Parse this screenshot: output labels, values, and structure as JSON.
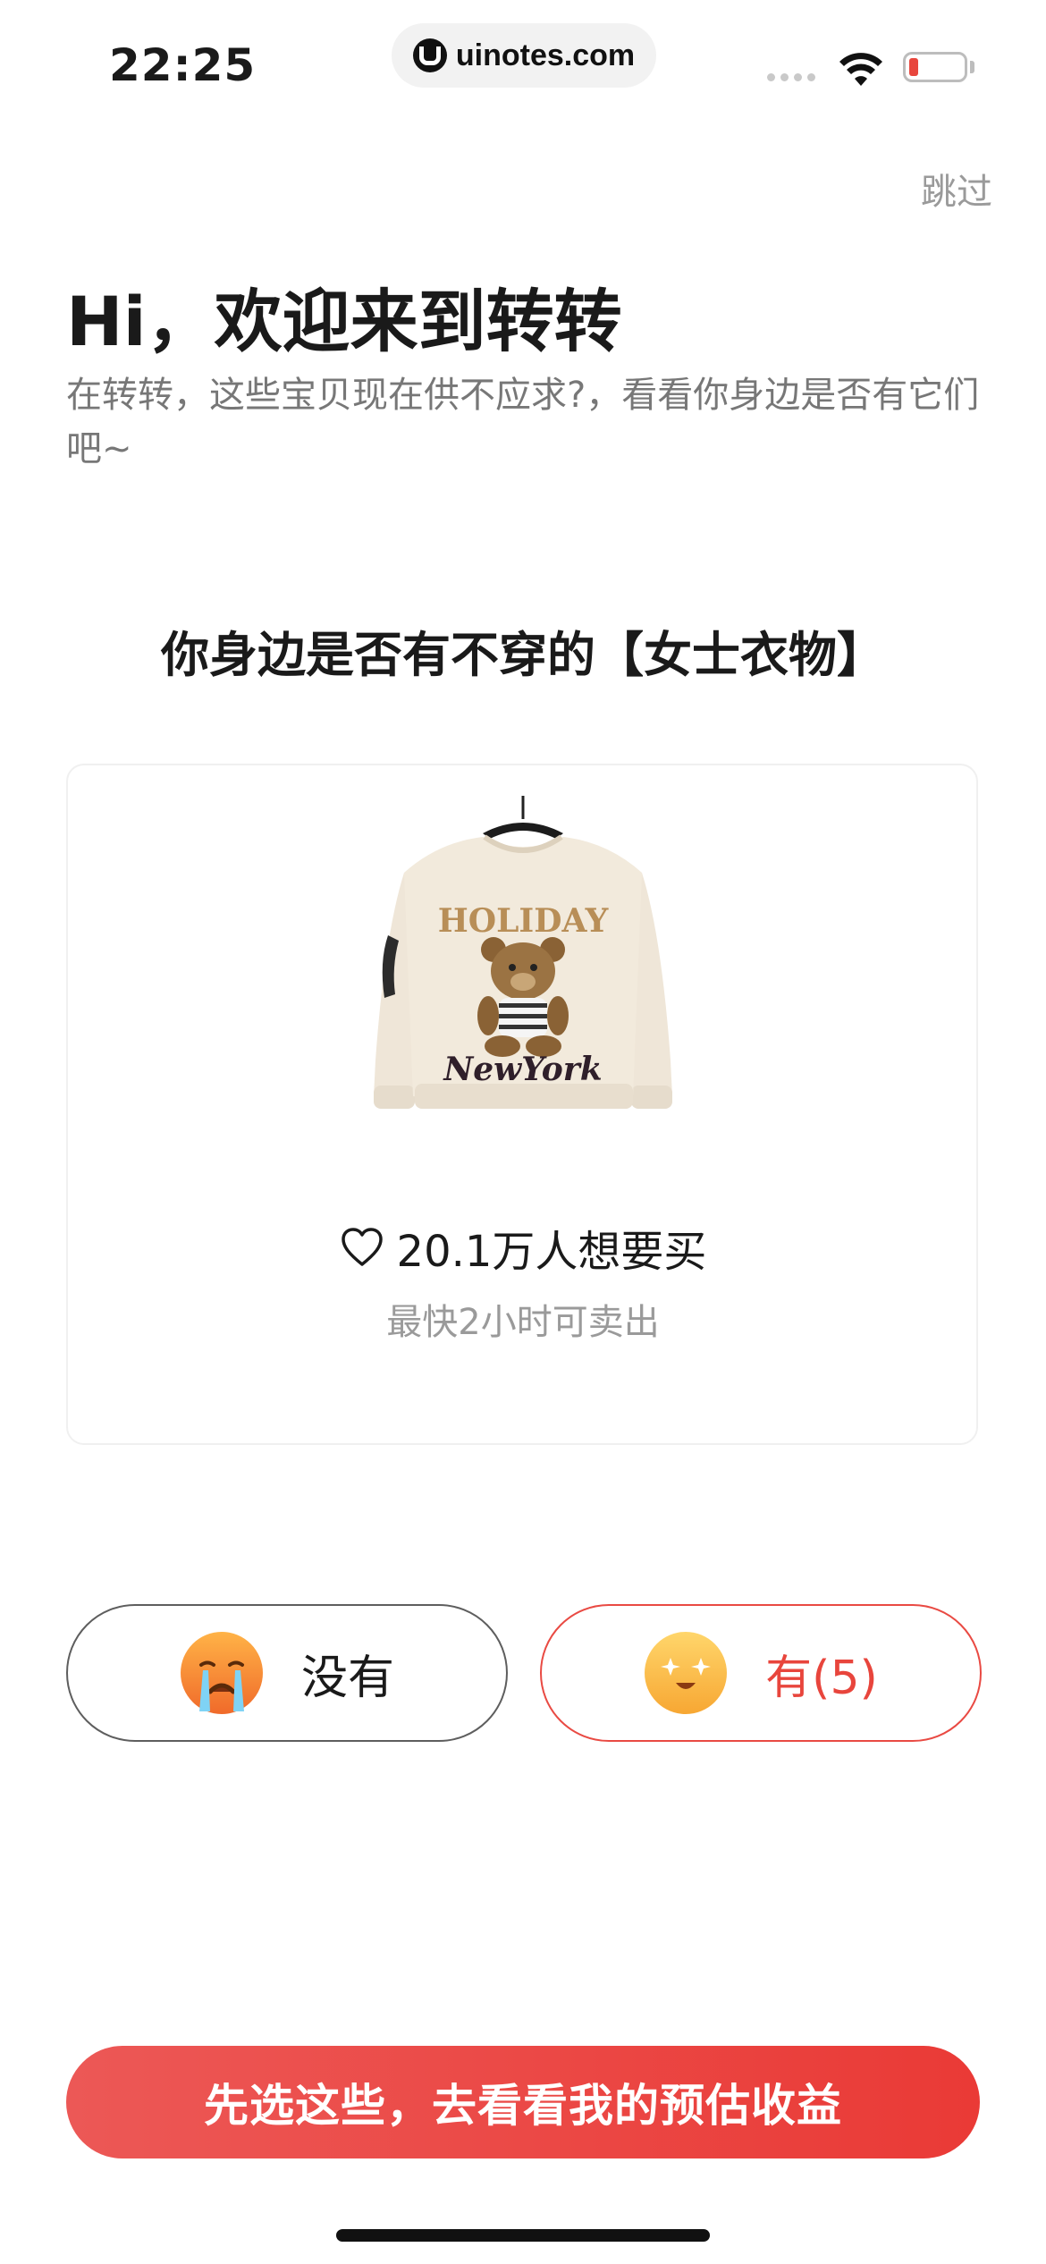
{
  "status_bar": {
    "time": "22:25",
    "url": "uinotes.com"
  },
  "header": {
    "skip_label": "跳过"
  },
  "welcome": {
    "title": "Hi，欢迎来到转转",
    "subtitle": "在转转，这些宝贝现在供不应求?，看看你身边是否有它们吧~"
  },
  "question": "你身边是否有不穿的【女士衣物】",
  "item_card": {
    "image": "cream sweatshirt with bear print reading HOLIDAY / NewYork",
    "image_text_top": "HOLIDAY",
    "image_text_bottom": "NewYork",
    "want_count": "20.1万人想要买",
    "sell_speed": "最快2小时可卖出"
  },
  "answers": {
    "no_label": "没有",
    "yes_label": "有(5)"
  },
  "cta_label": "先选这些，去看看我的预估收益",
  "colors": {
    "accent_red": "#e8453c",
    "cta_gradient_start": "#ec5856",
    "cta_gradient_end": "#ea3a36",
    "muted_text": "#9a9a9a"
  },
  "icons": [
    "url-logo-icon",
    "cellular-signal-icon",
    "wifi-icon",
    "battery-icon",
    "heart-icon",
    "crying-face-icon",
    "star-eyes-face-icon"
  ]
}
